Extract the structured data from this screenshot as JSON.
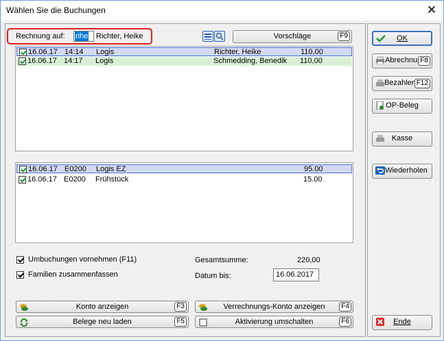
{
  "window": {
    "title": "Wählen Sie die Buchungen",
    "close_symbol": "✕"
  },
  "rechnung": {
    "label": "Rechnung auf:",
    "code": "rihe",
    "name": "Richter, Heike"
  },
  "toolbar": {
    "vorschlaege_label": "Vorschläge",
    "vorschlaege_key": "F9"
  },
  "bookings": [
    {
      "date": "16.06.17",
      "time": "14:14",
      "type": "Logis",
      "name": "Richter, Heike",
      "amount": "110,00",
      "checked": true
    },
    {
      "date": "16.06.17",
      "time": "14:17",
      "type": "Logis",
      "name": "Schmedding, Benedik",
      "amount": "110,00",
      "checked": true
    }
  ],
  "items": [
    {
      "date": "16.06.17",
      "code": "E0200",
      "desc": "Logis EZ",
      "amount": "95.00",
      "checked": true
    },
    {
      "date": "16.06.17",
      "code": "E0200",
      "desc": "Frühstück",
      "amount": "15.00",
      "checked": true
    }
  ],
  "options": {
    "umbuchungen_label": "Umbuchungen vornehmen (F11)",
    "familien_label": "Familien zusammenfassen"
  },
  "summary": {
    "gesamtsumme_label": "Gesamtsumme:",
    "gesamtsumme_value": "220,00",
    "datum_label": "Datum bis:",
    "datum_value": "16.06.2017"
  },
  "bottom_buttons": {
    "konto_label": "Konto anzeigen",
    "konto_key": "F3",
    "verrechnung_label": "Verrechnungs-Konto anzeigen",
    "verrechnung_key": "F4",
    "belege_label": "Belege neu laden",
    "belege_key": "F5",
    "aktivierung_label": "Aktivierung umschalten",
    "aktivierung_key": "F6"
  },
  "side_buttons": {
    "ok_label": "OK",
    "abrechnung_label": "Abrechnun",
    "abrechnung_key": "F8",
    "bezahlen_label": "Bezahlen",
    "bezahlen_key": "F12",
    "opbeleg_label": "OP-Beleg",
    "kasse_label": "Kasse",
    "wiederholen_label": "Wiederholen",
    "ende_label": "Ende"
  },
  "colors": {
    "highlight_red": "#e02020",
    "selection_blue": "#4a6bd6",
    "row_green": "#d9f0d7",
    "accent": "#0078d7"
  }
}
